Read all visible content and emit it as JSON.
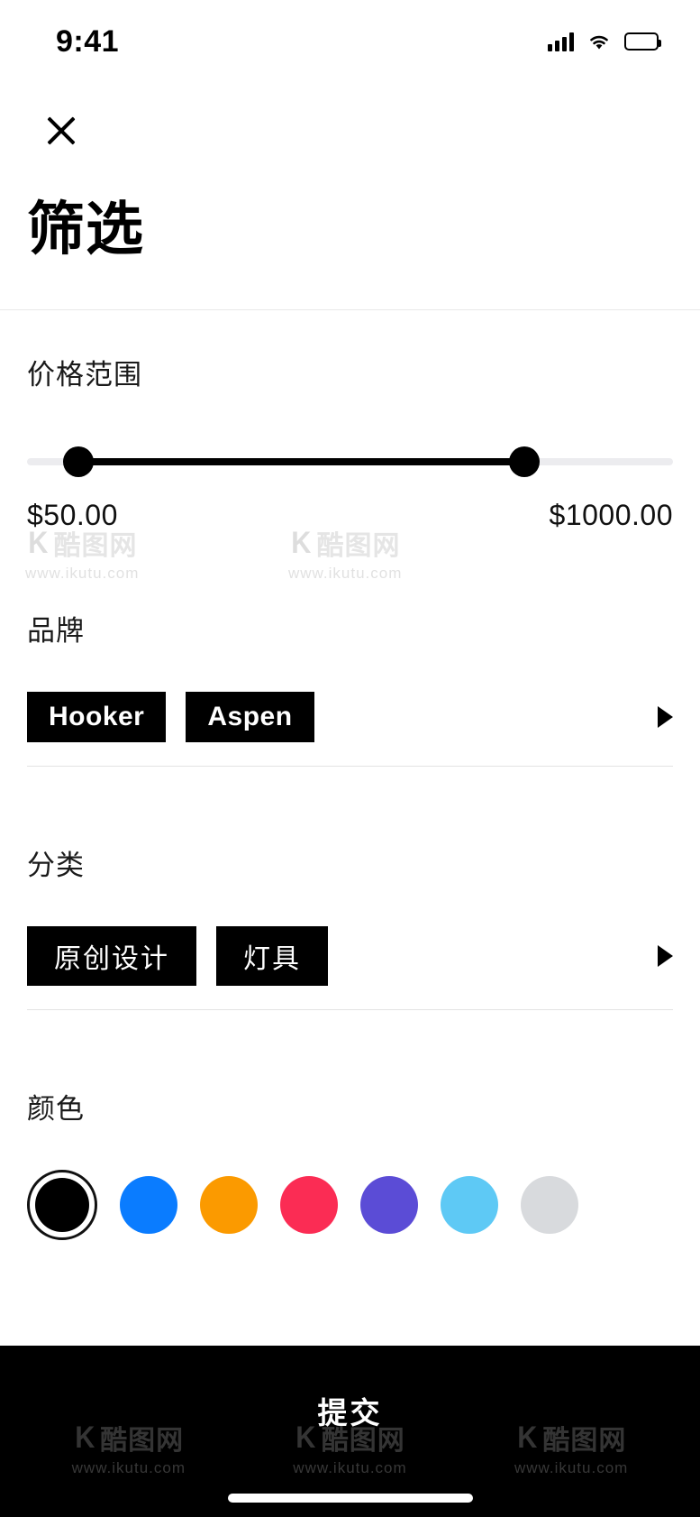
{
  "status_bar": {
    "time": "9:41",
    "cellular_icon": "cellular-signal-icon",
    "wifi_icon": "wifi-icon",
    "battery_icon": "battery-icon"
  },
  "header": {
    "close_icon": "close-icon",
    "title": "筛选"
  },
  "price": {
    "label": "价格范围",
    "min_value": "$50.00",
    "max_value": "$1000.00",
    "min_percent": 8,
    "max_percent": 77
  },
  "brand": {
    "label": "品牌",
    "chips": [
      "Hooker",
      "Aspen"
    ],
    "more_icon": "chevron-right-icon"
  },
  "category": {
    "label": "分类",
    "chips": [
      "原创设计",
      "灯具"
    ],
    "more_icon": "chevron-right-icon"
  },
  "color": {
    "label": "颜色",
    "swatches": [
      {
        "name": "black",
        "hex": "#000000",
        "selected": true
      },
      {
        "name": "blue",
        "hex": "#0a7cff",
        "selected": false
      },
      {
        "name": "orange",
        "hex": "#fb9a00",
        "selected": false
      },
      {
        "name": "pink",
        "hex": "#fb2c54",
        "selected": false
      },
      {
        "name": "purple",
        "hex": "#5b4cd6",
        "selected": false
      },
      {
        "name": "sky",
        "hex": "#5ec9f5",
        "selected": false
      },
      {
        "name": "grey",
        "hex": "#d8dadd",
        "selected": false
      }
    ]
  },
  "footer": {
    "submit_label": "提交",
    "home_indicator": "home-indicator"
  },
  "watermark": {
    "mark": "K",
    "brand": "酷图网",
    "url": "www.ikutu.com"
  }
}
